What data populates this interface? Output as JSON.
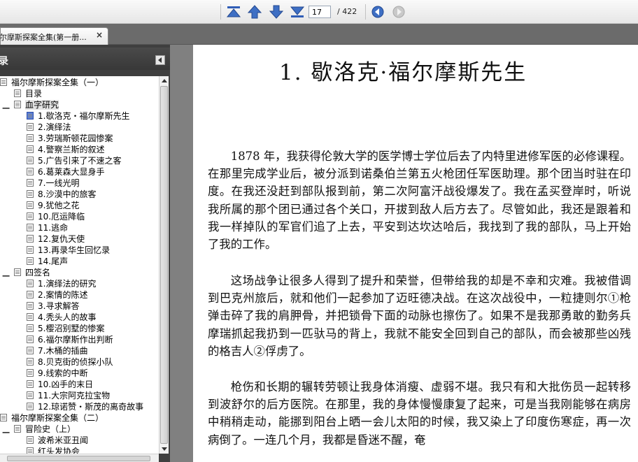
{
  "toolbar": {
    "page_current": "17",
    "page_total": "/ 422",
    "buttons": [
      "first-page",
      "prev-page",
      "next-page",
      "last-page",
      "go-back",
      "go-forward"
    ]
  },
  "tab": {
    "label": "尔摩斯探案全集(第一册...",
    "close": "×"
  },
  "sidebar": {
    "title": "录",
    "collapse_glyph": "◀",
    "items": [
      "福尔摩斯探案全集（一）",
      "目录",
      "血字研究",
      "1.歇洛克・福尔摩斯先生",
      "2.演绎法",
      "3.劳瑞斯顿花园惨案",
      "4.警察兰斯的叙述",
      "5.广告引来了不速之客",
      "6.葛莱森大显身手",
      "7.一线光明",
      "8.沙漠中的旅客",
      "9.犹他之花",
      "10.厄运降临",
      "11.逃命",
      "12.复仇天使",
      "13.再录华生回忆录",
      "14.尾声",
      "四签名",
      "1.演绎法的研究",
      "2.案情的陈述",
      "3.寻求解答",
      "4.秃头人的故事",
      "5.樱沼别墅的惨案",
      "6.福尔摩斯作出判断",
      "7.木桶的插曲",
      "8.贝克街的侦探小队",
      "9.线索的中断",
      "10.凶手的末日",
      "11.大宗阿克拉宝物",
      "12.琼诺赞・斯茂的离奇故事",
      "福尔摩斯探案全集（二）",
      "冒险史（上）",
      "波希米亚丑闻",
      "红头发协会"
    ]
  },
  "document": {
    "chapter_title": "1. 歇洛克·福尔摩斯先生",
    "paragraphs": [
      "1878 年，我获得伦敦大学的医学博士学位后去了内特里进修军医的必修课程。在那里完成学业后，被分派到诺桑伯兰第五火枪团任军医助理。那个团当时驻在印度。在我还没赶到部队报到前，第二次阿富汗战役爆发了。我在孟买登岸时，听说我所属的那个团已通过各个关口，开拔到敌人后方去了。尽管如此，我还是跟着和我一样掉队的军官们追了上去，平安到达坎达哈后，我找到了我的部队，马上开始了我的工作。",
      "这场战争让很多人得到了提升和荣誉，但带给我的却是不幸和灾难。我被借调到巴克州旅后，就和他们一起参加了迈旺德决战。在这次战役中，一粒捷则尔①枪弹击碎了我的肩胛骨，并把锁骨下面的动脉也擦伤了。如果不是我那勇敢的勤务兵摩瑞抓起我扔到一匹驮马的背上，我就不能安全回到自己的部队，而会被那些凶残的格吉人②俘虏了。",
      "枪伤和长期的辗转劳顿让我身体消瘦、虚弱不堪。我只有和大批伤员一起转移到波舒尔的后方医院。在那里，我的身体慢慢康复了起来，可是当我刚能够在病房中稍稍走动，能挪到阳台上晒一会儿太阳的时候，我又染上了印度伤寒症，再一次病倒了。一连几个月，我都是昏迷不醒，奄"
    ]
  },
  "colors": {
    "toolbar_icon": "#3e6fc4",
    "sidebar_bg": "#3f3f3f",
    "doc_bg": "#808080",
    "selected_icon": "#5a7fd8"
  }
}
